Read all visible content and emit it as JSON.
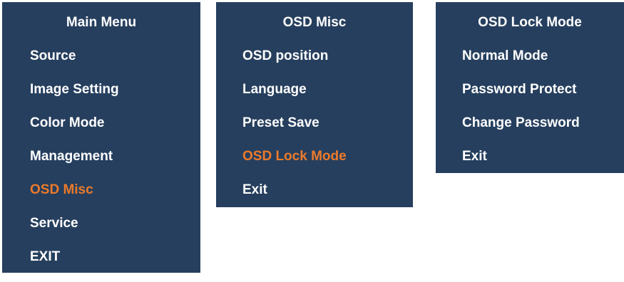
{
  "accent_color": "#ec7a2b",
  "panel_color": "#263f5e",
  "main_menu": {
    "title": "Main Menu",
    "items": [
      {
        "label": "Source",
        "selected": false
      },
      {
        "label": "Image Setting",
        "selected": false
      },
      {
        "label": "Color Mode",
        "selected": false
      },
      {
        "label": "Management",
        "selected": false
      },
      {
        "label": "OSD Misc",
        "selected": true
      },
      {
        "label": "Service",
        "selected": false
      },
      {
        "label": "EXIT",
        "selected": false
      }
    ]
  },
  "osd_misc": {
    "title": "OSD Misc",
    "items": [
      {
        "label": "OSD position",
        "selected": false
      },
      {
        "label": "Language",
        "selected": false
      },
      {
        "label": "Preset Save",
        "selected": false
      },
      {
        "label": "OSD Lock Mode",
        "selected": true
      },
      {
        "label": "Exit",
        "selected": false
      }
    ]
  },
  "osd_lock_mode": {
    "title": "OSD Lock Mode",
    "items": [
      {
        "label": "Normal Mode",
        "selected": false
      },
      {
        "label": "Password Protect",
        "selected": false
      },
      {
        "label": "Change Password",
        "selected": false
      },
      {
        "label": "Exit",
        "selected": false
      }
    ]
  }
}
